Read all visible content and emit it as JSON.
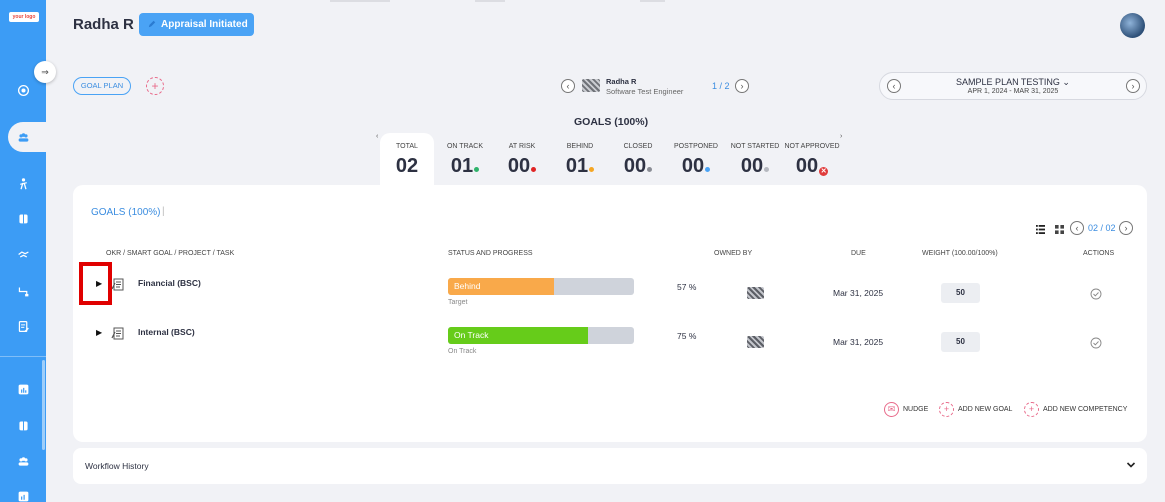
{
  "sidebar": {
    "logo_text": "your logo",
    "collapse_glyph": "⇒",
    "icons": [
      "target-icon",
      "team-icon",
      "person-icon",
      "book-icon",
      "handshake-icon",
      "flow-icon",
      "edit-doc-icon",
      "report-icon",
      "book-icon",
      "group-icon",
      "chart-icon"
    ]
  },
  "header": {
    "user_name": "Radha R",
    "status_label": "Appraisal Initiated"
  },
  "plan_bar": {
    "goal_plan_label": "GOAL PLAN",
    "add_glyph": "+",
    "employee_name": "Radha R",
    "employee_role": "Software Test Engineer",
    "employee_page": "1 / 2",
    "plan_name": "SAMPLE PLAN TESTING ⌄",
    "plan_dates": "APR 1, 2024 - MAR 31, 2025",
    "prev_glyph": "‹",
    "next_glyph": "›"
  },
  "summary": {
    "title": "GOALS (100%)",
    "stats": [
      {
        "label": "TOTAL",
        "value": "02",
        "dot": ""
      },
      {
        "label": "ON TRACK",
        "value": "01",
        "dot": "#2fb36b"
      },
      {
        "label": "AT RISK",
        "value": "00",
        "dot": "#e02424"
      },
      {
        "label": "BEHIND",
        "value": "01",
        "dot": "#f5a623"
      },
      {
        "label": "CLOSED",
        "value": "00",
        "dot": "#8a8d95"
      },
      {
        "label": "POSTPONED",
        "value": "00",
        "dot": "#4aa3f5"
      },
      {
        "label": "NOT STARTED",
        "value": "00",
        "dot": "#b5b8bf"
      },
      {
        "label": "NOT APPROVED",
        "value": "00",
        "dot": "x"
      }
    ]
  },
  "goals_card": {
    "title": "GOALS (100%)",
    "separator": "|",
    "pager": "02 / 02",
    "columns": [
      "OKR / SMART GOAL / PROJECT / TASK",
      "STATUS AND PROGRESS",
      "OWNED BY",
      "DUE",
      "WEIGHT (100.00/100%)",
      "ACTIONS"
    ],
    "rows": [
      {
        "name": "Financial (BSC)",
        "status": "Behind",
        "status_color": "#f9a94a",
        "progress": 0.57,
        "sub": "Target",
        "pct": "57 %",
        "due": "Mar 31, 2025",
        "weight": "50"
      },
      {
        "name": "Internal (BSC)",
        "status": "On Track",
        "status_color": "#66cc1a",
        "progress": 0.75,
        "sub": "On Track",
        "pct": "75 %",
        "due": "Mar 31, 2025",
        "weight": "50"
      }
    ],
    "footer_actions": [
      "NUDGE",
      "ADD NEW GOAL",
      "ADD NEW COMPETENCY"
    ]
  },
  "workflow": {
    "title": "Workflow History"
  },
  "colors": {
    "sidebar": "#3c9cf5",
    "accent": "#3b8de0",
    "highlight": "#e00000"
  }
}
